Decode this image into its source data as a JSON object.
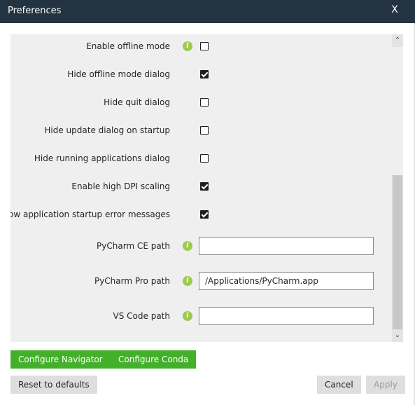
{
  "window": {
    "title": "Preferences",
    "close_label": "X"
  },
  "settings": {
    "rows": [
      {
        "label": "Enable offline mode",
        "info": true,
        "type": "checkbox",
        "checked": false
      },
      {
        "label": "Hide offline mode dialog",
        "info": false,
        "type": "checkbox",
        "checked": true
      },
      {
        "label": "Hide quit dialog",
        "info": false,
        "type": "checkbox",
        "checked": false
      },
      {
        "label": "Hide update dialog on startup",
        "info": false,
        "type": "checkbox",
        "checked": false
      },
      {
        "label": "Hide running applications dialog",
        "info": false,
        "type": "checkbox",
        "checked": false
      },
      {
        "label": "Enable high DPI scaling",
        "info": false,
        "type": "checkbox",
        "checked": true
      },
      {
        "label": "Show application startup error messages",
        "info": false,
        "type": "checkbox",
        "checked": true
      },
      {
        "label": "PyCharm CE path",
        "info": true,
        "type": "text",
        "value": ""
      },
      {
        "label": "PyCharm Pro path",
        "info": true,
        "type": "text",
        "value": "/Applications/PyCharm.app"
      },
      {
        "label": "VS Code path",
        "info": true,
        "type": "text",
        "value": ""
      }
    ],
    "info_glyph": "i"
  },
  "scrollbar": {
    "up_glyph": "⌃",
    "down_glyph": "⌄"
  },
  "buttons": {
    "configure_navigator": "Configure Navigator",
    "configure_conda": "Configure Conda",
    "reset_defaults": "Reset to defaults",
    "cancel": "Cancel",
    "apply": "Apply"
  },
  "colors": {
    "titlebar": "#243341",
    "accent_green": "#43b02a",
    "info_icon": "#9ccb4a",
    "panel_bg": "#efefef"
  }
}
